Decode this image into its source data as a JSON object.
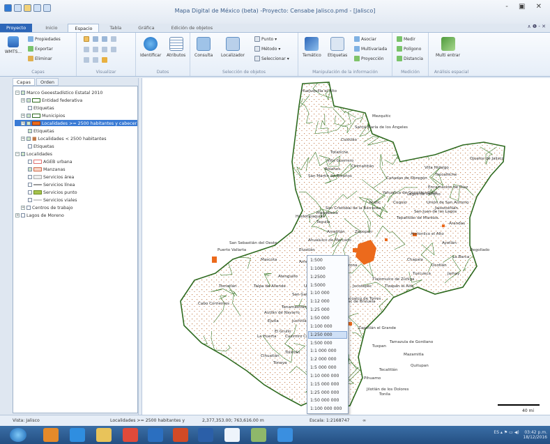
{
  "window": {
    "title": "Mapa Digital de México (beta) -Proyecto: Censabe Jalisco.pmd  - [Jalisco]",
    "controls": "- ▣ ✕"
  },
  "tabs": [
    {
      "label": "Proyecto"
    },
    {
      "label": "Inicio"
    },
    {
      "label": "Espacio"
    },
    {
      "label": "Tabla"
    },
    {
      "label": "Gráfica"
    },
    {
      "label": "Edición de objetos"
    }
  ],
  "tab_right": "∧ ❶ - ✕",
  "ribbon": {
    "capas": {
      "label": "Capas",
      "wmts": "WMTS...",
      "add_layer": "Añadir",
      "propiedades": "Propiedades",
      "exportar": "Exportar",
      "eliminar": "Eliminar"
    },
    "visualizar": {
      "label": "Visualizar"
    },
    "datos": {
      "label": "Datos",
      "identificar": "Identificar",
      "atributos": "Atributos"
    },
    "seleccion": {
      "label": "Selección de objetos",
      "consulta": "Consulta",
      "localizador": "Localizador",
      "punto": "Punto",
      "metodo": "Método",
      "seleccionar": "Seleccionar"
    },
    "manipulacion": {
      "label": "Manipulación de la información",
      "tematico": "Temático",
      "etiquetas": "Etiquetas",
      "asociar": "Asociar",
      "multivariada": "Multivariada",
      "proyeccion": "Proyección"
    },
    "medicion": {
      "label": "Medición",
      "medir": "Medir",
      "poligono": "Polígono",
      "distancia": "Distancia"
    },
    "analisis": {
      "label": "Análisis espacial",
      "multi": "Multi entrar"
    }
  },
  "left_tabs": [
    "Capas",
    "Orden"
  ],
  "layers": [
    {
      "label": "Marco Geoestadístico Estatal 2010"
    },
    {
      "label": "Entidad federativa"
    },
    {
      "label": "Etiquetas"
    },
    {
      "label": "Municipios"
    },
    {
      "label": "Localidades >= 2500 habitantes y cabecer"
    },
    {
      "label": "Etiquetas"
    },
    {
      "label": "Localidades < 2500 habitantes"
    },
    {
      "label": "Etiquetas"
    },
    {
      "label": "Localidades"
    },
    {
      "label": "AGEB urbana"
    },
    {
      "label": "Manzanas"
    },
    {
      "label": "Servicios área"
    },
    {
      "label": "Servicios línea"
    },
    {
      "label": "Servicios punto"
    },
    {
      "label": "Servicios viales"
    },
    {
      "label": "Centros de trabajo"
    },
    {
      "label": "Lagos de Moreno"
    }
  ],
  "map_labels": [
    "Huejuquilla el Alto",
    "Mezquitic",
    "Santa María de los Ángeles",
    "Colotlán",
    "Totatiche",
    "Villa Guerrero",
    "Bolaños",
    "San Martín de Bolaños",
    "Chimaltitán",
    "Villa Hidalgo",
    "Ojuelos de Jalisco",
    "Teocaltiche",
    "Encarnación de Díaz",
    "Lagos de Moreno",
    "Unión de San Antonio",
    "San Juan de los Lagos",
    "Jalostotitlán",
    "Tepatitlán de Morelos",
    "Arandas",
    "Atotonilco el Alto",
    "Ayotlán",
    "La Barca",
    "Ocotlán",
    "Chapala",
    "Tlajomulco de Zúñiga",
    "Zapopan",
    "Tequila",
    "Amatitán",
    "Ahualulco de Mercado",
    "Ameca",
    "Talpa de Allende",
    "Mascota",
    "Puerto Vallarta",
    "San Sebastián del Oeste",
    "Tomatlán",
    "Cabo Corrientes",
    "Atenguillo",
    "Autlán de Navarro",
    "Cihuatlán",
    "La Huerta",
    "Casimiro Castillo",
    "Tuxpan",
    "Zapotlán el Grande",
    "Tamazula de Gordiano",
    "Mazamitla",
    "Quitupan",
    "Pihuamo",
    "Tecalitlán",
    "Jilotlán de los Dolores",
    "Sayula",
    "Tapalpa",
    "Atemajac de Brizuela",
    "Jocotepec",
    "Tizapán el Alto",
    "Tuxcueca",
    "San Cristóbal de la Barranca",
    "Hostotipaquillo",
    "Magdalena",
    "Etzatlán",
    "Cocula",
    "Villa Corona",
    "Zacoalco de Torres",
    "Tonila",
    "Jamay",
    "Degollado",
    "Yahualica de González Gallo",
    "Cuquío",
    "Acatic",
    "Cañadas de Obregón",
    "Tenamaxtlán",
    "Juchitlán",
    "Unión de Tula",
    "San Gabriel",
    "Tolimán",
    "Tonaya",
    "Ejutla",
    "El Grullo"
  ],
  "scale_menu": {
    "items": [
      "1:500",
      "1:1000",
      "1:2500",
      "1:5000",
      "1:10 000",
      "1:12 000",
      "1:25 000",
      "1:50 000",
      "1:100 000",
      "1:250 000",
      "1:500 000",
      "1:1 000 000",
      "1:2 000 000",
      "1:5 000 000",
      "1:10 000 000",
      "1:15 000 000",
      "1:25 000 000",
      "1:50 000 000",
      "1:100 000 000"
    ],
    "selected_index": 9
  },
  "scalebar_label": "40 mi",
  "status": {
    "location": "Vista: Jalisco",
    "layer": "Localidades >= 2500 habitantes y",
    "coords": "2,377,353.00; 763,616.00 m",
    "scale": "Escala: 1:2168747",
    "extra": "∞"
  },
  "taskbar": {
    "tray_left": "ES  ▴  ⚑ ▭ ◀)",
    "time": "03:42 p.m.",
    "date": "18/12/2016"
  },
  "colors": {
    "accent": "#2d66b8",
    "border_green": "#2e6a1f",
    "urban_orange": "#ec6a1c",
    "locality_brown": "#c07a4a"
  }
}
